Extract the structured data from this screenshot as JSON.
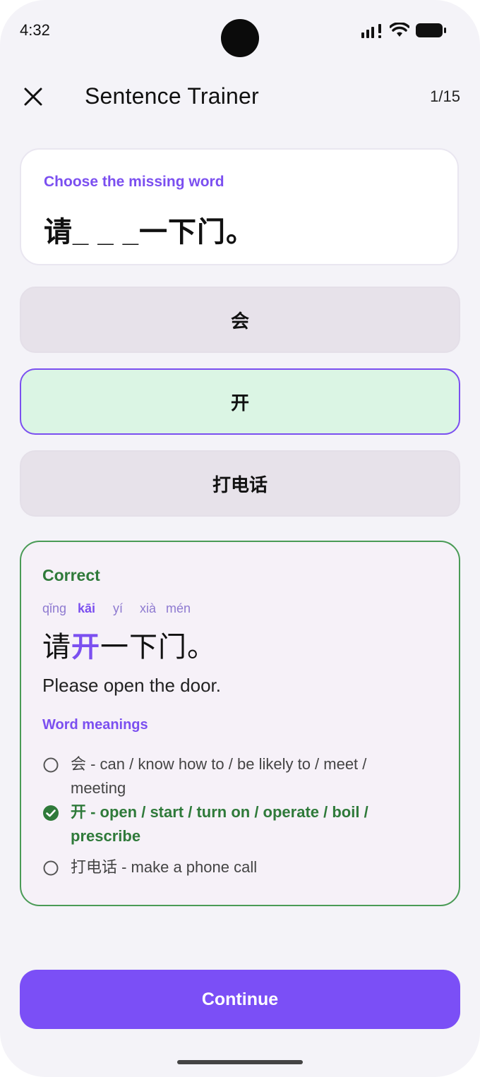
{
  "status_bar": {
    "time": "4:32"
  },
  "header": {
    "title": "Sentence Trainer",
    "progress": "1/15"
  },
  "question": {
    "prompt": "Choose the missing word",
    "sentence": "请_ _ _一下门。"
  },
  "options": [
    {
      "label": "会",
      "state": "default"
    },
    {
      "label": "开",
      "state": "selected"
    },
    {
      "label": "打电话",
      "state": "default"
    }
  ],
  "feedback": {
    "status": "Correct",
    "pinyin": [
      "qǐng",
      "kāi",
      "yí",
      "xià",
      "mén"
    ],
    "sentence_before": "请",
    "sentence_highlight": "开",
    "sentence_after": "一下门。",
    "translation": "Please open the door.",
    "meanings_title": "Word meanings",
    "meanings": [
      {
        "text": "会 - can / know how to / be likely to / meet / meeting",
        "correct": false
      },
      {
        "text": "开 - open / start / turn on / operate / boil / prescribe",
        "correct": true
      },
      {
        "text": "打电话 - make a phone call",
        "correct": false
      }
    ]
  },
  "continue_label": "Continue",
  "colors": {
    "accent": "#7b4ff6",
    "correct_green": "#2f7a3a",
    "selected_bg": "#dbf5e4",
    "option_bg": "#e7e2ea"
  }
}
